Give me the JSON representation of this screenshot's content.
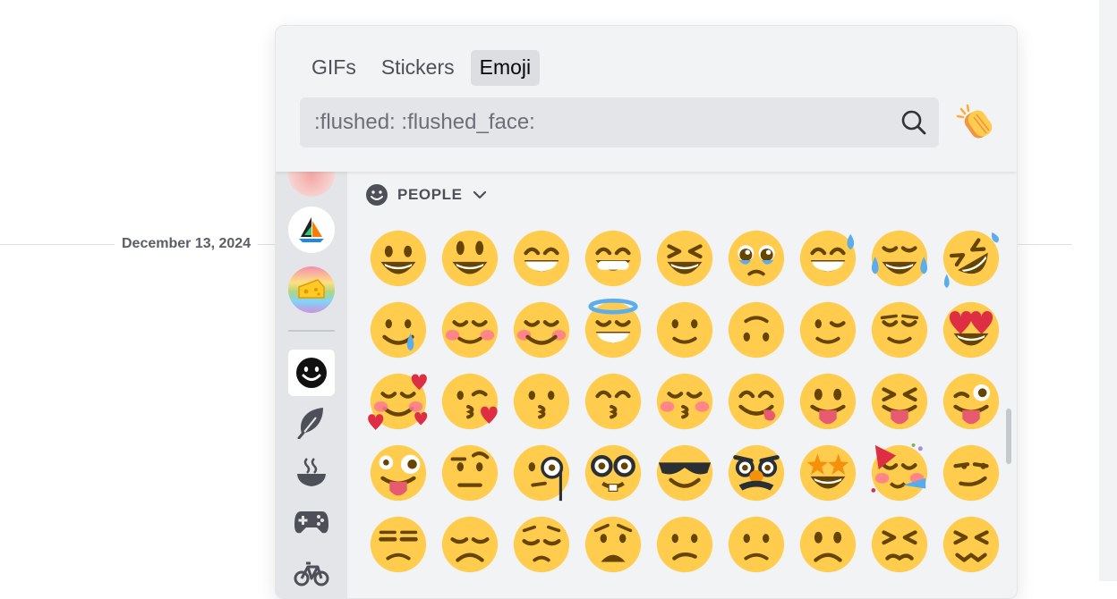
{
  "timeline": {
    "date_divider": "December 13, 2024"
  },
  "picker": {
    "tabs": [
      {
        "label": "GIFs",
        "active": false
      },
      {
        "label": "Stickers",
        "active": false
      },
      {
        "label": "Emoji",
        "active": true
      }
    ],
    "search": {
      "value": ":flushed: :flushed_face:",
      "icon": "search-icon"
    },
    "random_emoji_button": {
      "icon": "clapping-hands-icon"
    },
    "section": {
      "label": "PEOPLE",
      "icon": "smiley-icon",
      "toggle_icon": "chevron-down-icon"
    },
    "sidebar": {
      "servers": [
        "server-pink-icon",
        "server-sailboat-icon",
        "server-cheese-rainbow-icon"
      ],
      "categories": [
        {
          "icon": "smiley-face-icon",
          "active": true
        },
        {
          "icon": "leaf-icon",
          "active": false
        },
        {
          "icon": "food-bowl-icon",
          "active": false
        },
        {
          "icon": "gamepad-icon",
          "active": false
        },
        {
          "icon": "bicycle-icon",
          "active": false
        }
      ]
    },
    "emojis": [
      "grinning",
      "smiley",
      "smile",
      "grin",
      "laughing",
      "pleading_face",
      "sweat_smile",
      "joy",
      "rofl",
      "smiling_face_with_tear",
      "blush_hands",
      "relaxed",
      "innocent",
      "slight_smile",
      "upside_down",
      "wink",
      "relieved",
      "heart_eyes",
      "smiling_face_with_3_hearts",
      "kissing_heart",
      "kissing",
      "kissing_smiling_eyes",
      "kissing_closed_eyes",
      "yum",
      "stuck_out_tongue",
      "stuck_out_tongue_closed_eyes",
      "stuck_out_tongue_winking_eye",
      "zany_face",
      "face_with_raised_eyebrow",
      "face_with_monocle",
      "nerd",
      "sunglasses",
      "disguised_face",
      "star_struck",
      "partying_face",
      "smirk",
      "unamused",
      "disappointed",
      "pensive",
      "worried",
      "confused",
      "slight_frown",
      "frowning2",
      "persevere",
      "confounded"
    ]
  },
  "colors": {
    "emoji_yellow": "#ffcc4d",
    "emoji_feature": "#664500",
    "tongue": "#e75a70",
    "heart": "#dd2e44",
    "tear": "#5dadec"
  }
}
